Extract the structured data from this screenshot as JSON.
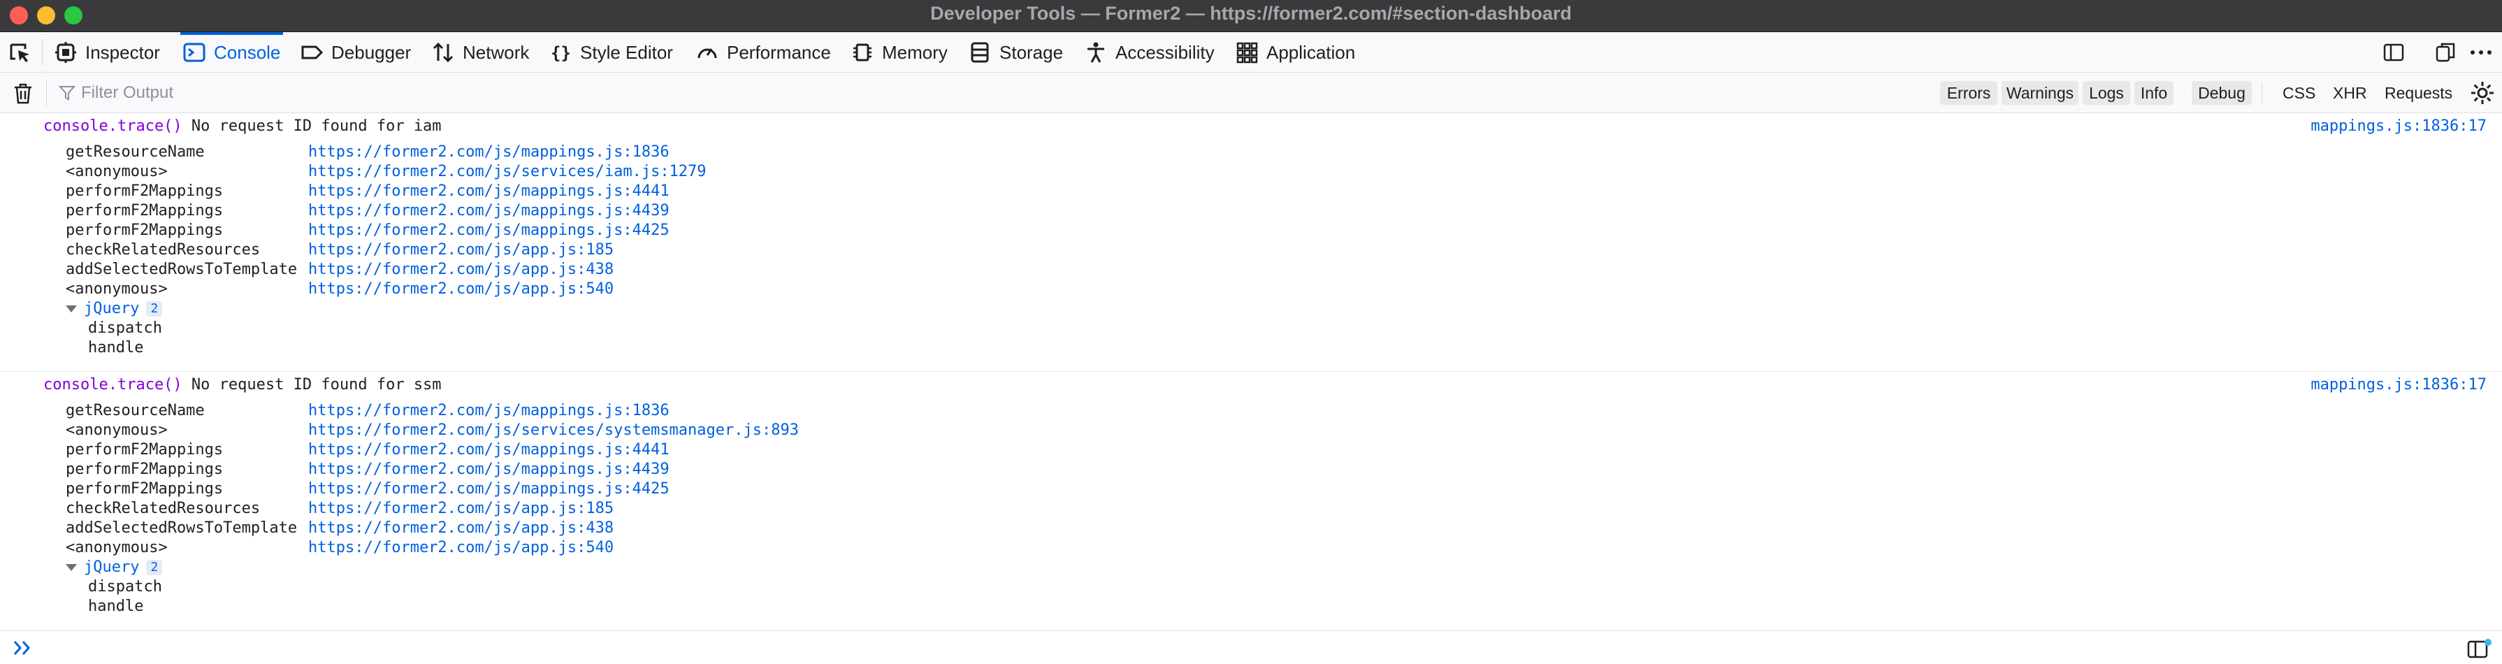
{
  "window": {
    "title": "Developer Tools — Former2 — https://former2.com/#section-dashboard"
  },
  "tabs": [
    {
      "label": "Inspector",
      "icon": "inspector-icon"
    },
    {
      "label": "Console",
      "icon": "console-icon",
      "active": true
    },
    {
      "label": "Debugger",
      "icon": "debugger-icon"
    },
    {
      "label": "Network",
      "icon": "network-icon"
    },
    {
      "label": "Style Editor",
      "icon": "style-editor-icon"
    },
    {
      "label": "Performance",
      "icon": "performance-icon"
    },
    {
      "label": "Memory",
      "icon": "memory-icon"
    },
    {
      "label": "Storage",
      "icon": "storage-icon"
    },
    {
      "label": "Accessibility",
      "icon": "accessibility-icon"
    },
    {
      "label": "Application",
      "icon": "application-icon"
    }
  ],
  "filter": {
    "placeholder": "Filter Output",
    "levels": [
      "Errors",
      "Warnings",
      "Logs",
      "Info",
      "Debug"
    ],
    "extras": [
      "CSS",
      "XHR",
      "Requests"
    ]
  },
  "colors": {
    "accent": "#0061e0",
    "link": "#0060df",
    "keyword": "#8000d7",
    "titlebar": "#3a3a3c"
  },
  "messages": [
    {
      "prefix": "console.trace()",
      "text": " No request ID found for iam",
      "location": "mappings.js:1836:17",
      "frames": [
        {
          "fn": "getResourceName",
          "url": "https://former2.com/js/mappings.js:1836"
        },
        {
          "fn": "<anonymous>",
          "url": "https://former2.com/js/services/iam.js:1279"
        },
        {
          "fn": "performF2Mappings",
          "url": "https://former2.com/js/mappings.js:4441"
        },
        {
          "fn": "performF2Mappings",
          "url": "https://former2.com/js/mappings.js:4439"
        },
        {
          "fn": "performF2Mappings",
          "url": "https://former2.com/js/mappings.js:4425"
        },
        {
          "fn": "checkRelatedResources",
          "url": "https://former2.com/js/app.js:185"
        },
        {
          "fn": "addSelectedRowsToTemplate",
          "url": "https://former2.com/js/app.js:438"
        },
        {
          "fn": "<anonymous>",
          "url": "https://former2.com/js/app.js:540"
        }
      ],
      "group": {
        "label": "jQuery",
        "count": "2",
        "items": [
          "dispatch",
          "handle"
        ]
      }
    },
    {
      "prefix": "console.trace()",
      "text": " No request ID found for ssm",
      "location": "mappings.js:1836:17",
      "frames": [
        {
          "fn": "getResourceName",
          "url": "https://former2.com/js/mappings.js:1836"
        },
        {
          "fn": "<anonymous>",
          "url": "https://former2.com/js/services/systemsmanager.js:893"
        },
        {
          "fn": "performF2Mappings",
          "url": "https://former2.com/js/mappings.js:4441"
        },
        {
          "fn": "performF2Mappings",
          "url": "https://former2.com/js/mappings.js:4439"
        },
        {
          "fn": "performF2Mappings",
          "url": "https://former2.com/js/mappings.js:4425"
        },
        {
          "fn": "checkRelatedResources",
          "url": "https://former2.com/js/app.js:185"
        },
        {
          "fn": "addSelectedRowsToTemplate",
          "url": "https://former2.com/js/app.js:438"
        },
        {
          "fn": "<anonymous>",
          "url": "https://former2.com/js/app.js:540"
        }
      ],
      "group": {
        "label": "jQuery",
        "count": "2",
        "items": [
          "dispatch",
          "handle"
        ]
      }
    }
  ]
}
